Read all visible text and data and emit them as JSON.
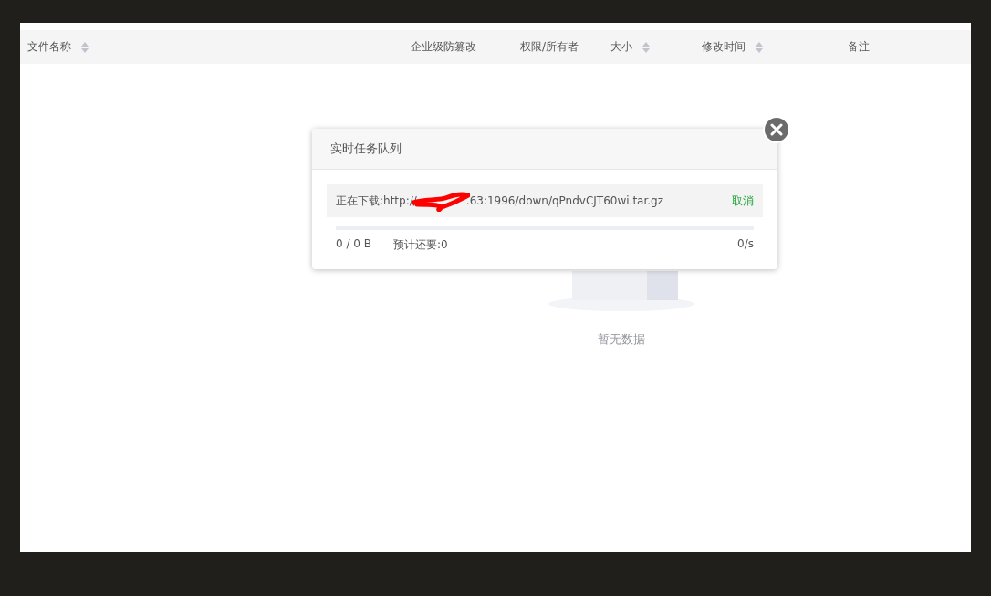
{
  "table": {
    "columns": [
      {
        "label": "文件名称",
        "sortable": true
      },
      {
        "label": "企业级防篡改",
        "sortable": false
      },
      {
        "label": "权限/所有者",
        "sortable": false
      },
      {
        "label": "大小",
        "sortable": true
      },
      {
        "label": "修改时间",
        "sortable": true
      },
      {
        "label": "备注",
        "sortable": false
      }
    ],
    "empty_text": "暂无数据"
  },
  "dialog": {
    "title": "实时任务队列",
    "task": {
      "prefix": "正在下载:http://",
      "suffix": ".63:1996/down/qPndvCJT60wi.tar.gz",
      "cancel": "取消",
      "level": 0,
      "transferred": "0 / 0 B",
      "eta": "预计还要:0",
      "speed": "0/s"
    }
  }
}
